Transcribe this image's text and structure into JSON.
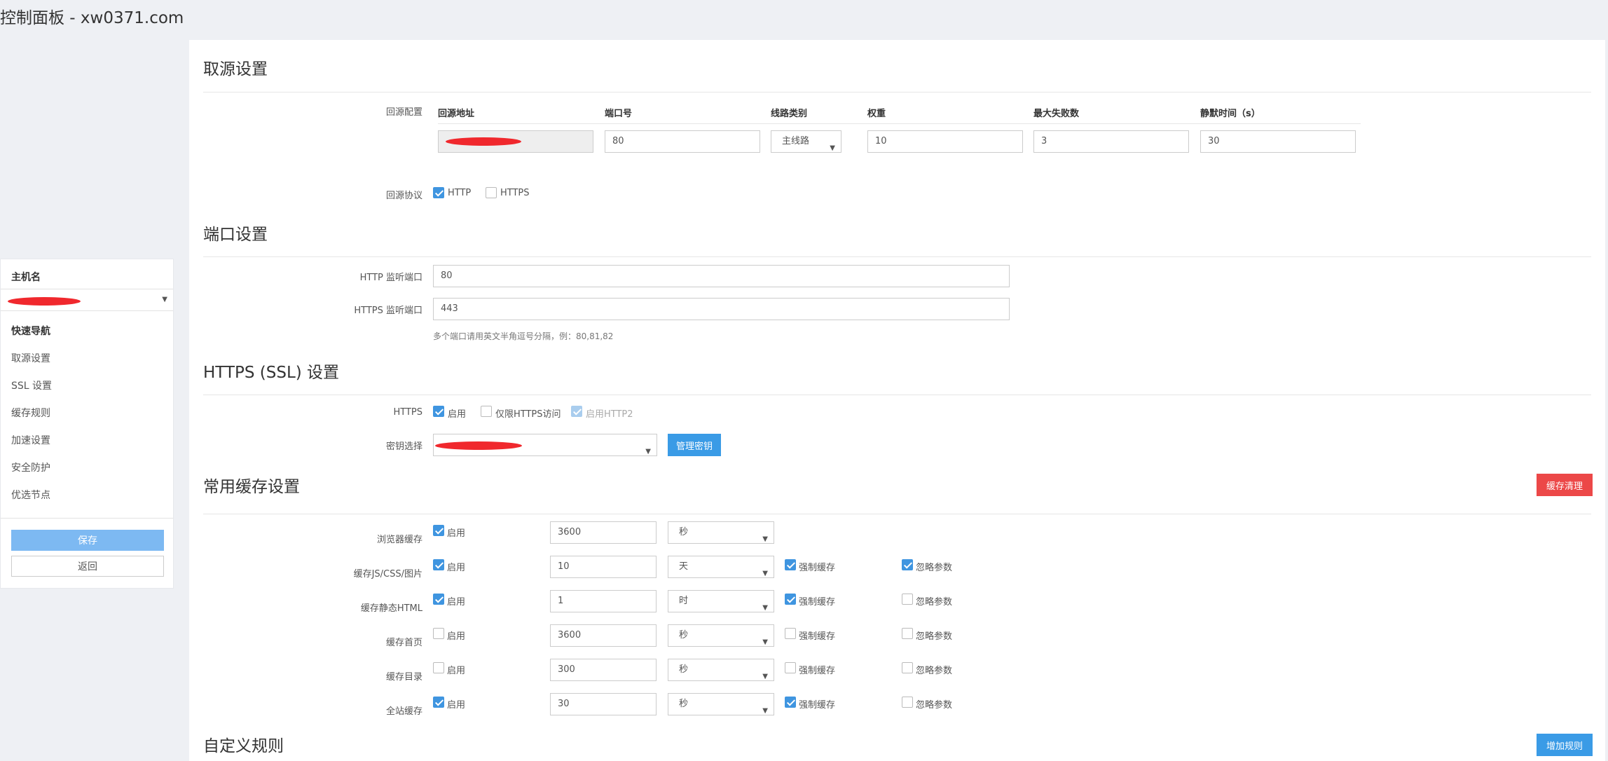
{
  "page": {
    "title": "控制面板 - xw0371.com"
  },
  "sidebar": {
    "host_label": "主机名",
    "nav_label": "快速导航",
    "nav_items": [
      "取源设置",
      "SSL 设置",
      "缓存规则",
      "加速设置",
      "安全防护",
      "优选节点"
    ],
    "save_label": "保存",
    "back_label": "返回"
  },
  "origin": {
    "title": "取源设置",
    "config_label": "回源配置",
    "columns": [
      "回源地址",
      "端口号",
      "线路类别",
      "权重",
      "最大失败数",
      "静默时间（s）"
    ],
    "row": {
      "port": "80",
      "line_type": "主线路",
      "weight": "10",
      "max_fails": "3",
      "silent_time": "30"
    },
    "protocol_label": "回源协议",
    "protocols": [
      {
        "label": "HTTP",
        "checked": true
      },
      {
        "label": "HTTPS",
        "checked": false
      }
    ]
  },
  "ports": {
    "title": "端口设置",
    "http_label": "HTTP 监听端口",
    "http_value": "80",
    "https_label": "HTTPS 监听端口",
    "https_value": "443",
    "hint": "多个端口请用英文半角逗号分隔，例：80,81,82"
  },
  "ssl": {
    "title": "HTTPS (SSL) 设置",
    "https_label": "HTTPS",
    "options": [
      {
        "label": "启用",
        "state": "on"
      },
      {
        "label": "仅限HTTPS访问",
        "state": "off"
      },
      {
        "label": "启用HTTP2",
        "state": "disabled"
      }
    ],
    "key_label": "密钥选择",
    "manage_key_label": "管理密钥"
  },
  "cache": {
    "title": "常用缓存设置",
    "clear_label": "缓存清理",
    "enable_text": "启用",
    "force_text": "强制缓存",
    "ignore_text": "忽略参数",
    "rows": [
      {
        "label": "浏览器缓存",
        "enabled": true,
        "value": "3600",
        "unit": "秒",
        "force": null,
        "ignore": null
      },
      {
        "label": "缓存JS/CSS/图片",
        "enabled": true,
        "value": "10",
        "unit": "天",
        "force": true,
        "ignore": true
      },
      {
        "label": "缓存静态HTML",
        "enabled": true,
        "value": "1",
        "unit": "时",
        "force": true,
        "ignore": false
      },
      {
        "label": "缓存首页",
        "enabled": false,
        "value": "3600",
        "unit": "秒",
        "force": false,
        "ignore": false
      },
      {
        "label": "缓存目录",
        "enabled": false,
        "value": "300",
        "unit": "秒",
        "force": false,
        "ignore": false
      },
      {
        "label": "全站缓存",
        "enabled": true,
        "value": "30",
        "unit": "秒",
        "force": true,
        "ignore": false
      }
    ]
  },
  "custom": {
    "title": "自定义规则",
    "add_label": "增加规则"
  },
  "colors": {
    "primary": "#3a9be6",
    "danger": "#ec4848",
    "redaction": "#f0282d"
  },
  "icons": {
    "checkbox": "check-icon",
    "dropdown": "chevron-down-icon"
  }
}
